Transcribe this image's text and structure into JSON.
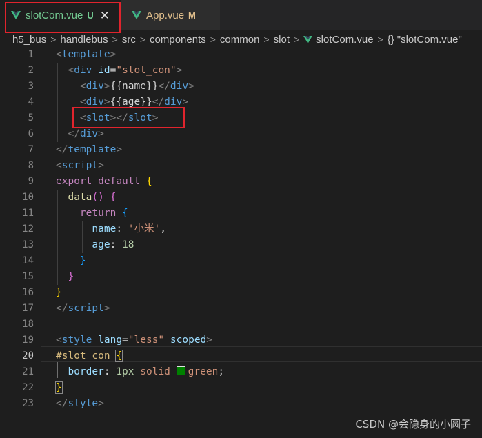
{
  "tabs": [
    {
      "name": "slotCom.vue",
      "status": "U"
    },
    {
      "name": "App.vue",
      "status": "M"
    }
  ],
  "colors": {
    "vue_green": "#41b883",
    "vue_dark": "#35495e",
    "highlight_red": "#e0242d"
  },
  "breadcrumb": {
    "items": [
      "h5_bus",
      "handlebus",
      "src",
      "components",
      "common",
      "slot",
      "slotCom.vue"
    ],
    "symbol": "\"slotCom.vue\""
  },
  "line_numbers": [
    "1",
    "2",
    "3",
    "4",
    "5",
    "6",
    "7",
    "8",
    "9",
    "10",
    "11",
    "12",
    "13",
    "14",
    "15",
    "16",
    "17",
    "18",
    "19",
    "20",
    "21",
    "22",
    "23"
  ],
  "active_line": "20",
  "code": {
    "template_tag": "template",
    "div_tag": "div",
    "id_attr": "id",
    "id_value": "\"slot_con\"",
    "name_expr": "{{name}}",
    "age_expr": "{{age}}",
    "slot_tag": "slot",
    "script_tag": "script",
    "export_kw": "export",
    "default_kw": "default",
    "data_fn": "data",
    "return_kw": "return",
    "name_prop": "name",
    "name_value": "'小米'",
    "age_prop": "age",
    "age_value": "18",
    "style_tag": "style",
    "lang_attr": "lang",
    "lang_value": "\"less\"",
    "scoped_attr": "scoped",
    "selector": "#slot_con",
    "border_prop": "border",
    "border_width": "1px",
    "border_style": "solid",
    "border_color": "green"
  },
  "watermark": "CSDN @会隐身的小圆子"
}
